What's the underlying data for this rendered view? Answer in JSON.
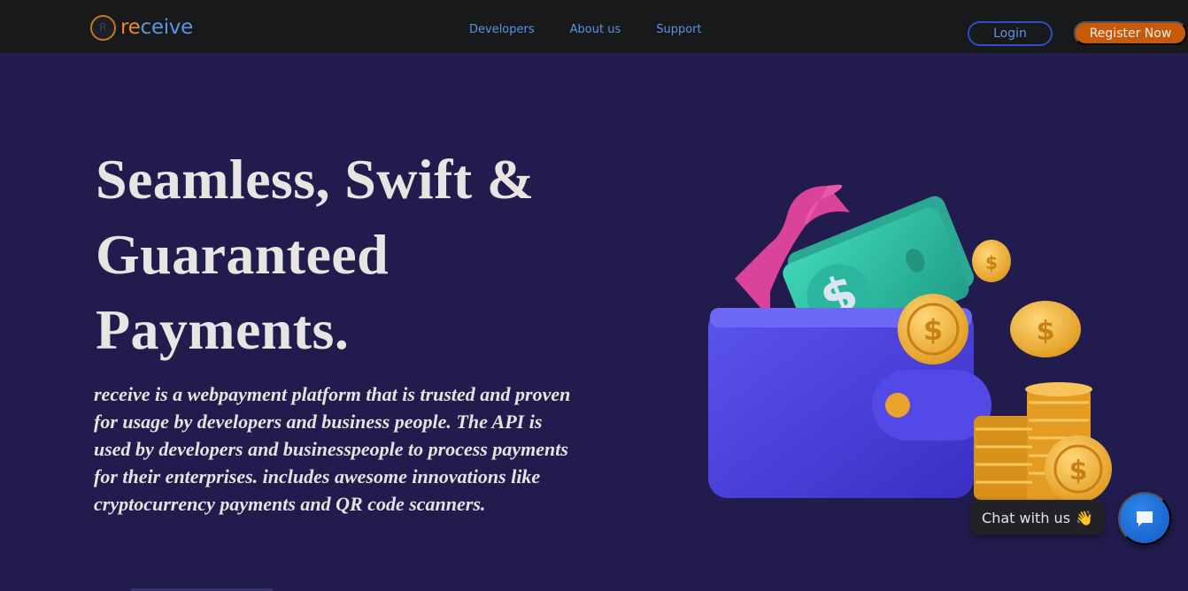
{
  "brand": {
    "logo_prefix": "re",
    "logo_suffix": "ceive",
    "logo_mark": "R"
  },
  "nav": {
    "links": [
      "Developers",
      "About us",
      "Support"
    ]
  },
  "auth": {
    "login_label": "Login",
    "register_label": "Register Now"
  },
  "hero": {
    "title_line1": "Seamless, Swift &",
    "title_line2": "Guaranteed",
    "title_line3": "Payments.",
    "description": "receive is a webpayment platform that is trusted and proven for usage by developers and business people. The API is used by developers and businesspeople to process payments for their enterprises. includes awesome innovations like cryptocurrency payments and QR code scanners."
  },
  "chat": {
    "label": "Chat with us",
    "emoji": "👋",
    "icon": "chat-bubble-icon"
  },
  "illustration": {
    "icon": "wallet-with-cash-and-coins-icon"
  },
  "colors": {
    "background": "#221c4e",
    "navbar": "#18191b",
    "link": "#5b93e4",
    "register_button": "#c65a0a",
    "chat_button": "#1e6fd9"
  }
}
